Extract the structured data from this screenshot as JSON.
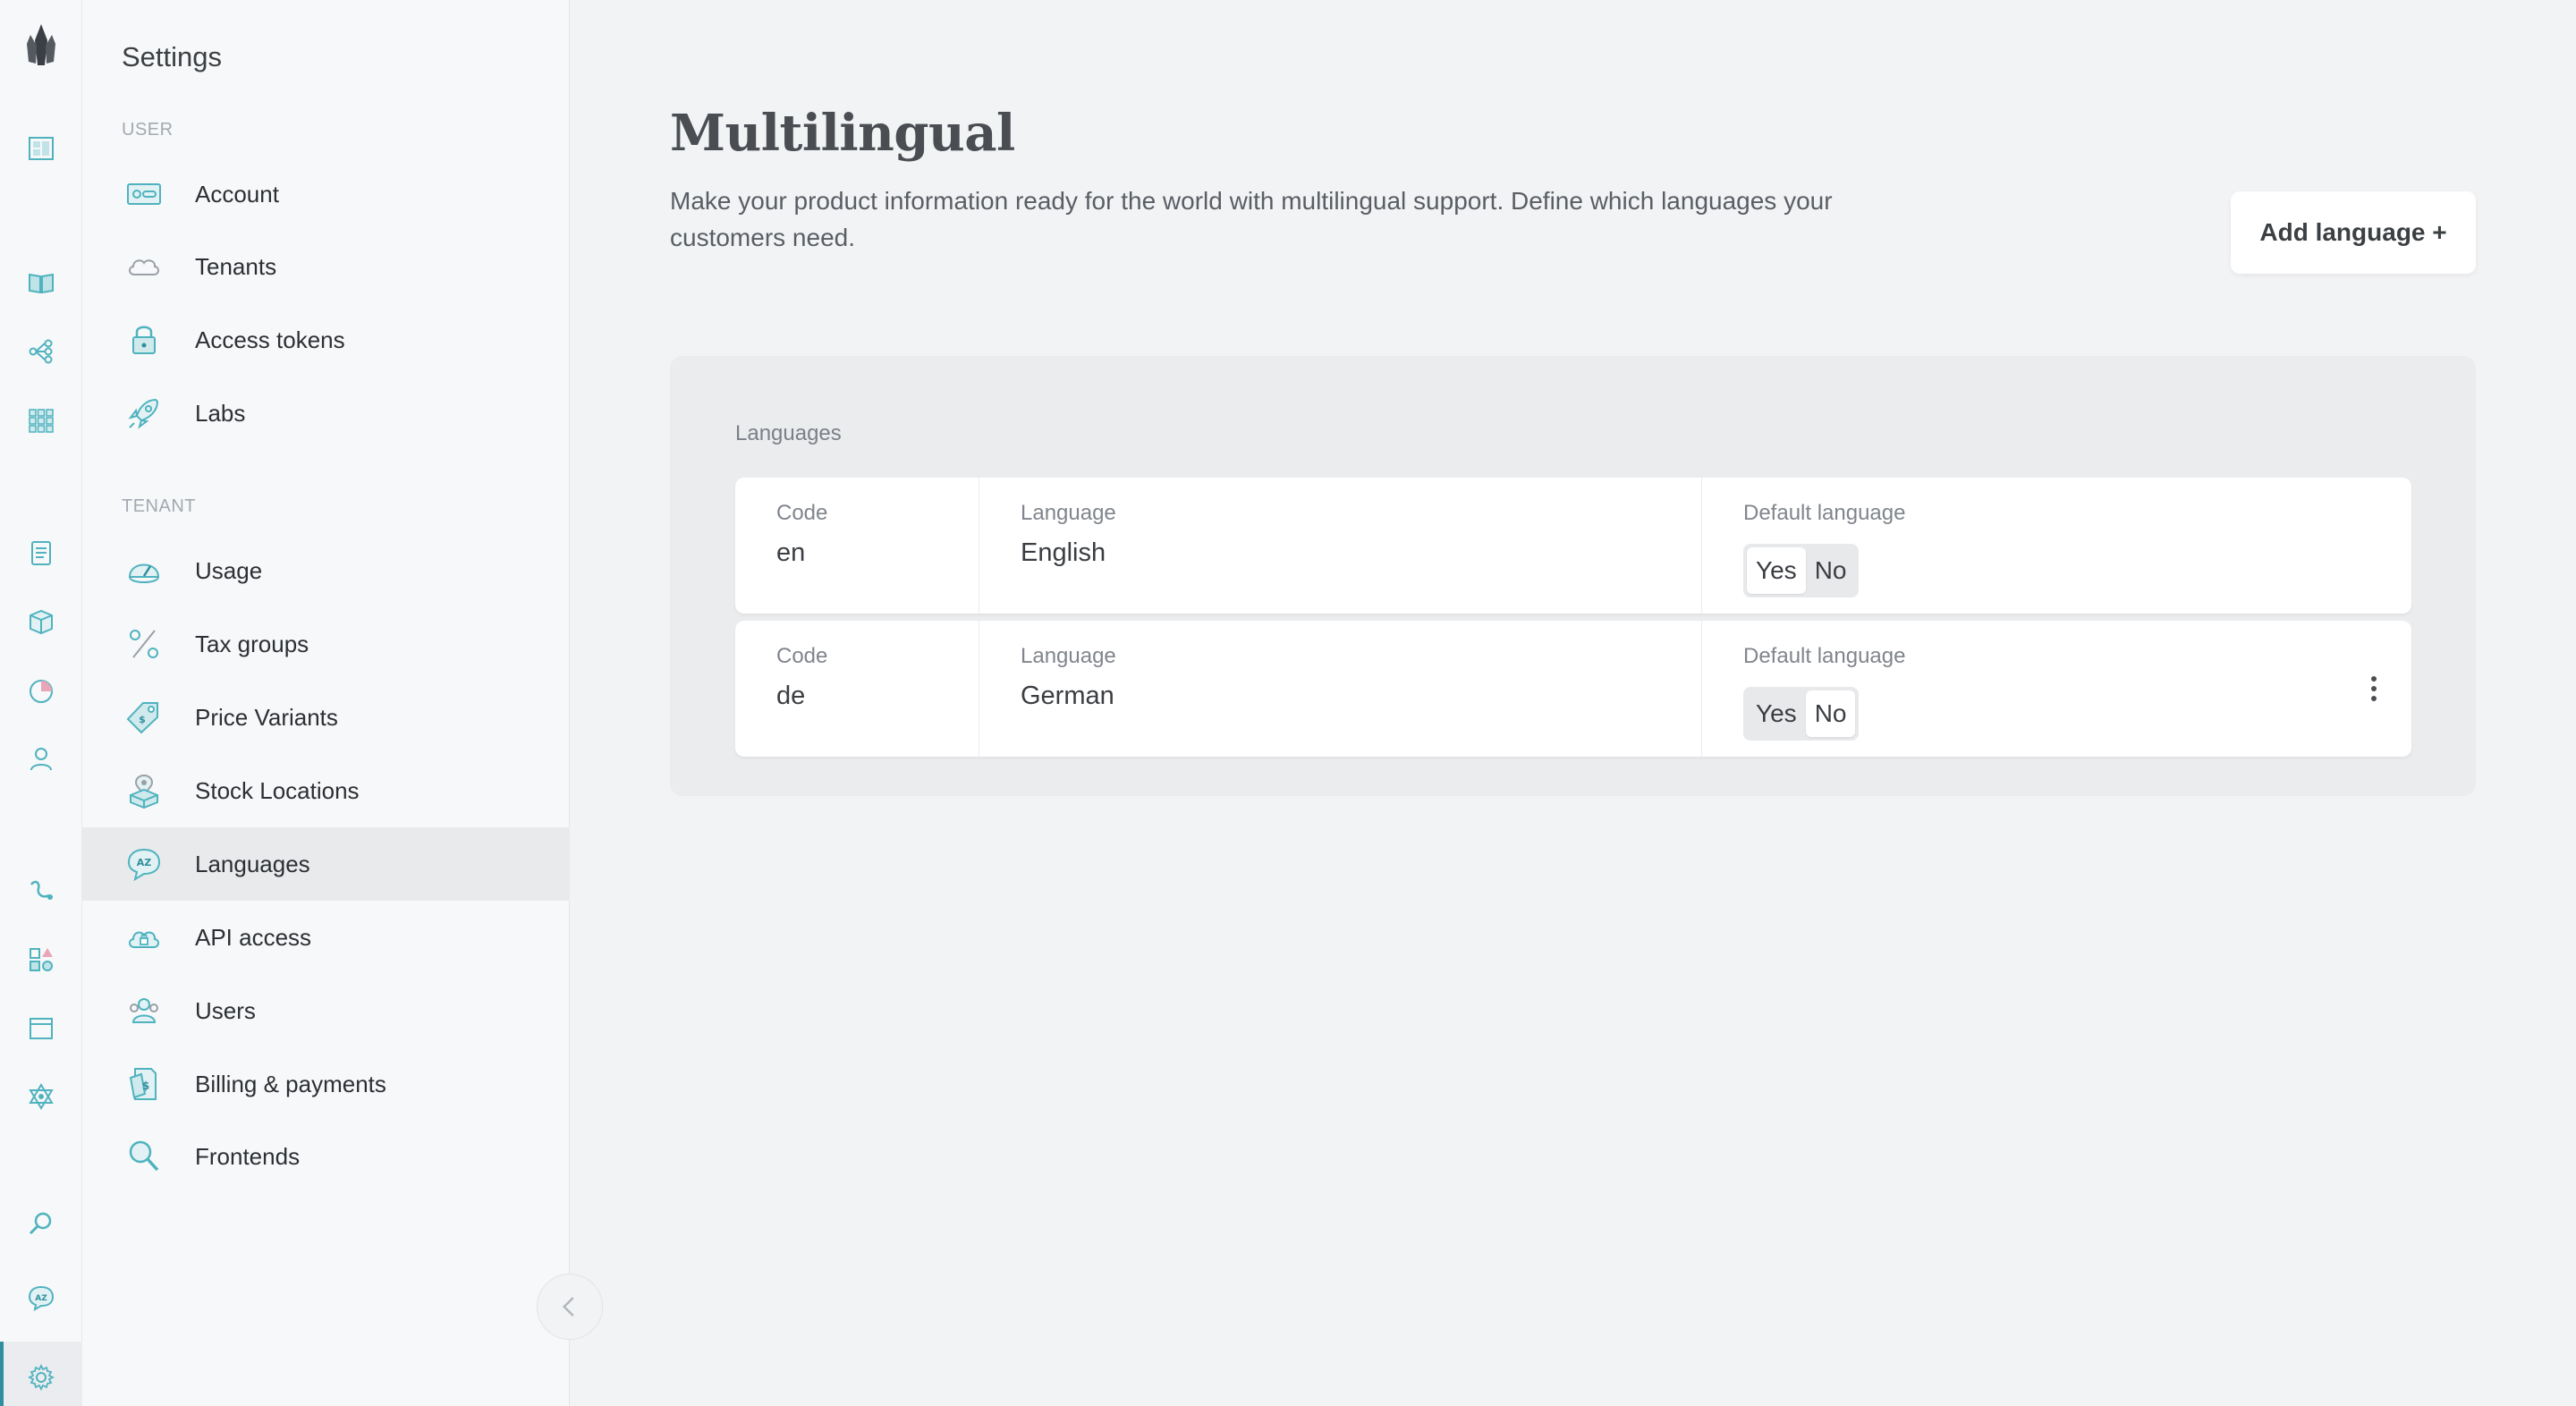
{
  "colors": {
    "accent": "#2f8f9d",
    "icon_teal": "#4fb3bf",
    "background": "#f2f3f5"
  },
  "rail": {
    "logo": "crystal-logo-icon",
    "icons": [
      "dashboard-icon",
      "catalogue-icon",
      "topics-icon",
      "grid-icon",
      "orders-icon",
      "box-icon",
      "pie-chart-icon",
      "customer-icon",
      "webhook-icon",
      "shapes-icon",
      "window-icon",
      "graph-icon",
      "search-icon",
      "language-icon",
      "settings-icon"
    ]
  },
  "settings": {
    "title": "Settings",
    "user_section": "USER",
    "tenant_section": "TENANT",
    "user_items": [
      {
        "label": "Account",
        "icon": "id-card-icon"
      },
      {
        "label": "Tenants",
        "icon": "cloud-icon"
      },
      {
        "label": "Access tokens",
        "icon": "lock-icon"
      },
      {
        "label": "Labs",
        "icon": "rocket-icon"
      }
    ],
    "tenant_items": [
      {
        "label": "Usage",
        "icon": "gauge-icon"
      },
      {
        "label": "Tax groups",
        "icon": "percent-icon"
      },
      {
        "label": "Price Variants",
        "icon": "price-tag-icon"
      },
      {
        "label": "Stock Locations",
        "icon": "stock-location-icon"
      },
      {
        "label": "Languages",
        "icon": "language-icon",
        "active": true
      },
      {
        "label": "API access",
        "icon": "api-cloud-icon"
      },
      {
        "label": "Users",
        "icon": "users-icon"
      },
      {
        "label": "Billing & payments",
        "icon": "billing-icon"
      },
      {
        "label": "Frontends",
        "icon": "magnifier-icon"
      }
    ]
  },
  "main": {
    "title": "Multilingual",
    "description": "Make your product information ready for the world with multilingual support. Define which languages your customers need.",
    "add_button": "Add language +",
    "panel_label": "Languages",
    "columns": {
      "code": "Code",
      "language": "Language",
      "default": "Default language"
    },
    "toggle": {
      "yes": "Yes",
      "no": "No"
    },
    "languages": [
      {
        "code": "en",
        "name": "English",
        "default": "Yes",
        "has_menu": false
      },
      {
        "code": "de",
        "name": "German",
        "default": "No",
        "has_menu": true
      }
    ]
  }
}
